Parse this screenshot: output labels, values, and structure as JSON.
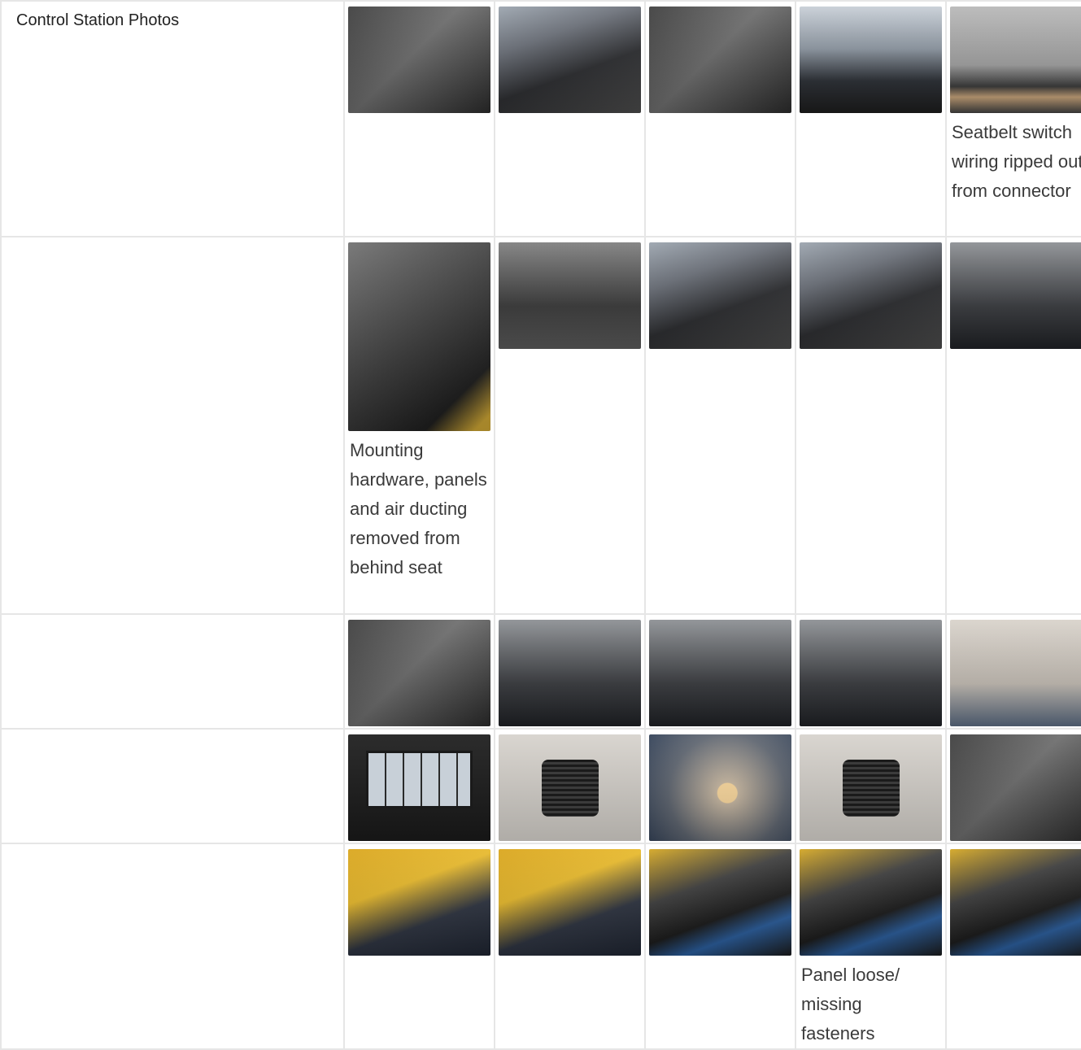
{
  "section_title": "Control Station Photos",
  "rows": [
    {
      "photos": [
        {
          "icon": "pedals-photo"
        },
        {
          "icon": "joystick-photo"
        },
        {
          "icon": "cab-floor-photo"
        },
        {
          "icon": "cab-window-photo"
        },
        {
          "icon": "seatbelt-wiring-photo",
          "caption": "Seatbelt switch wiring ripped out from connector"
        }
      ]
    },
    {
      "photos": [
        {
          "icon": "behind-seat-photo",
          "caption": "Mounting hardware, panels and air ducting removed from behind seat"
        },
        {
          "icon": "seat-belt-photo"
        },
        {
          "icon": "control-lever-photo"
        },
        {
          "icon": "control-lever-2-photo"
        },
        {
          "icon": "radio-panel-photo"
        }
      ]
    },
    {
      "photos": [
        {
          "icon": "aux-jack-photo"
        },
        {
          "icon": "cup-holder-photo"
        },
        {
          "icon": "storage-tray-photo"
        },
        {
          "icon": "cup-holder-2-photo"
        },
        {
          "icon": "roof-hatch-photo"
        }
      ]
    },
    {
      "photos": [
        {
          "icon": "roof-window-photo"
        },
        {
          "icon": "speaker-photo"
        },
        {
          "icon": "dome-light-photo"
        },
        {
          "icon": "speaker-2-photo"
        },
        {
          "icon": "power-outlet-photo"
        }
      ]
    },
    {
      "photos": [
        {
          "icon": "air-vents-photo"
        },
        {
          "icon": "switch-panel-photo"
        },
        {
          "icon": "monitor-console-photo"
        },
        {
          "icon": "monitor-panel-photo",
          "caption": "Panel loose/ missing fasteners"
        },
        {
          "icon": "monitor-front-photo"
        }
      ]
    }
  ]
}
